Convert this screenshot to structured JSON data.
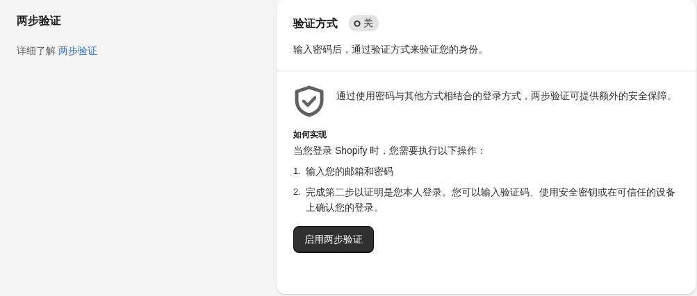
{
  "section": {
    "title": "两步验证",
    "learn_more": {
      "prefix": "详细了解",
      "link": "两步验证"
    }
  },
  "card": {
    "title": "验证方式",
    "status": {
      "label": "关",
      "on": false
    },
    "subtitle": "输入密码后，通过验证方式来验证您的身份。",
    "intro": "通过使用密码与其他方式相结合的登录方式，两步验证可提供额外的安全保障。",
    "how_heading": "如何实现",
    "how_text": "当您登录 Shopify 时，您需要执行以下操作：",
    "steps": [
      {
        "number": "1.",
        "text": "输入您的邮箱和密码"
      },
      {
        "number": "2.",
        "text": "完成第二步以证明是您本人登录。您可以输入验证码、使用安全密钥或在可信任的设备上确认您的登录。"
      }
    ],
    "button": "启用两步验证"
  }
}
